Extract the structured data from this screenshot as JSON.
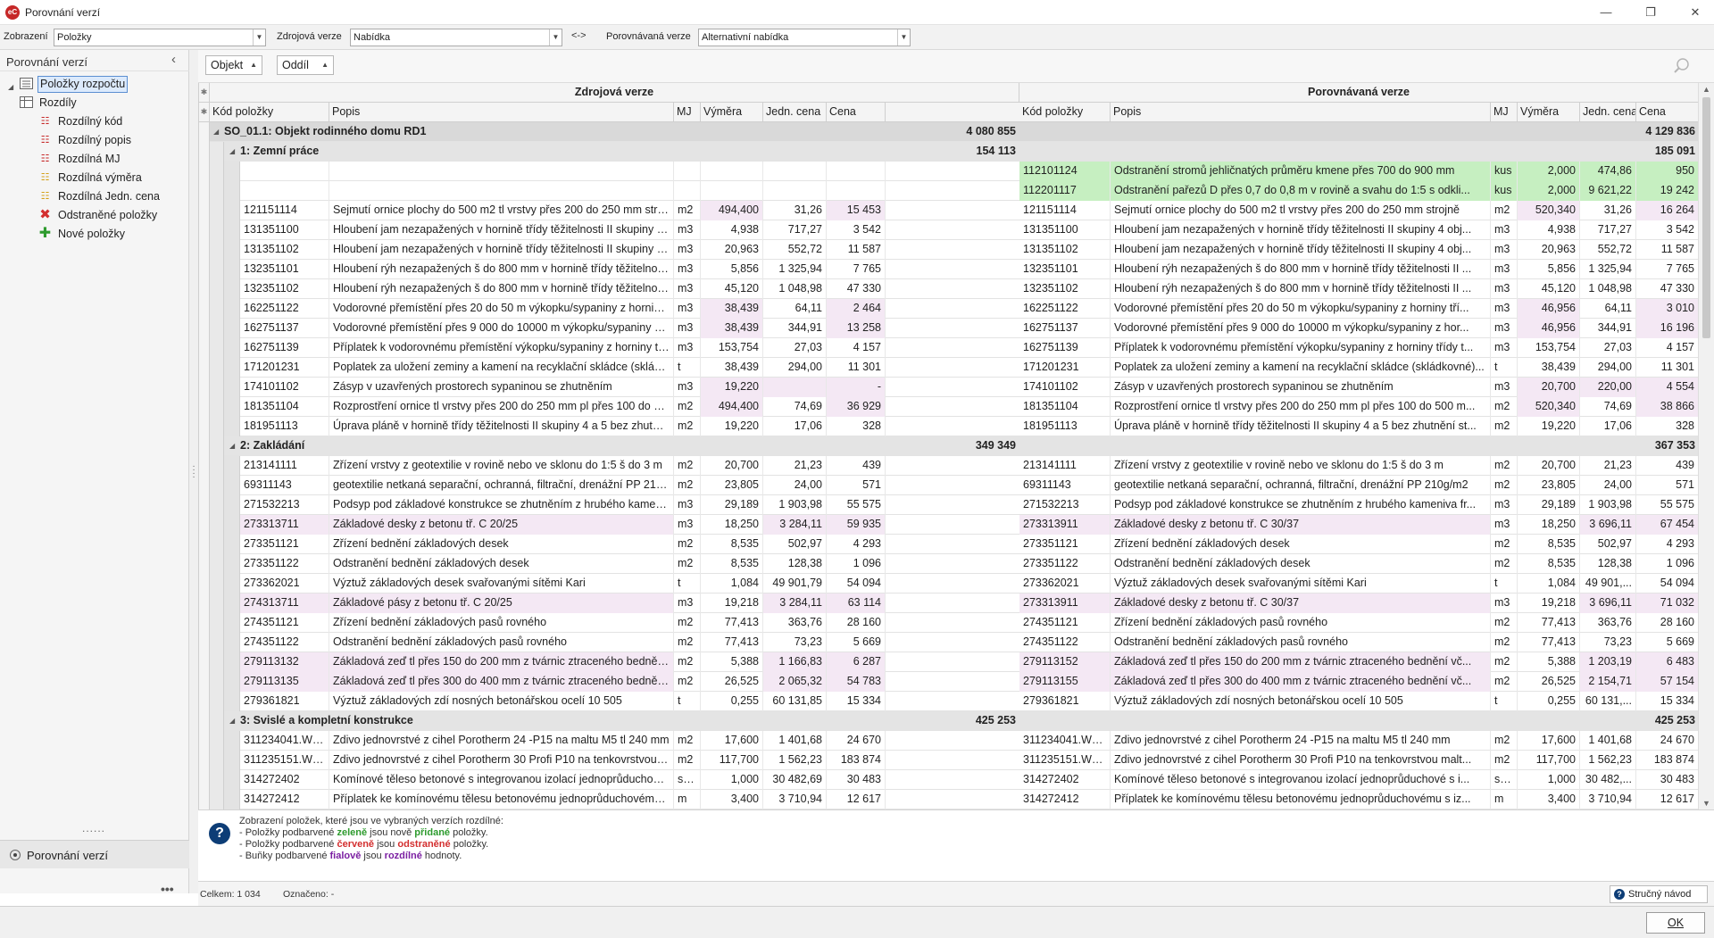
{
  "window": {
    "title": "Porovnání verzí",
    "app_icon": "eC",
    "controls": [
      "—",
      "❐",
      "✕"
    ]
  },
  "toolbar": {
    "view_label": "Zobrazení",
    "view_value": "Položky",
    "source_label": "Zdrojová verze",
    "source_value": "Nabídka",
    "swap_label": "<->",
    "compare_label": "Porovnávaná verze",
    "compare_value": "Alternativní nabídka"
  },
  "sidebar": {
    "title": "Porovnání verzí",
    "items": [
      {
        "label": "Položky rozpočtu",
        "icon": "list-icon"
      },
      {
        "label": "Rozdíly",
        "icon": "table-icon"
      },
      {
        "label": "Rozdílný kód",
        "icon": "diff-code-icon"
      },
      {
        "label": "Rozdílný popis",
        "icon": "diff-description-icon"
      },
      {
        "label": "Rozdílná MJ",
        "icon": "diff-unit-icon"
      },
      {
        "label": "Rozdílná výměra",
        "icon": "diff-quantity-icon"
      },
      {
        "label": "Rozdílná Jedn. cena",
        "icon": "diff-price-icon"
      },
      {
        "label": "Odstraněné položky",
        "icon": "red-x-icon"
      },
      {
        "label": "Nové položky",
        "icon": "green-plus-icon"
      }
    ],
    "dots": "......",
    "bottom_nav": "Porovnání verzí",
    "more": "•••"
  },
  "group_bar": {
    "buttons": [
      "Objekt",
      "Oddíl"
    ]
  },
  "grid": {
    "source_header": "Zdrojová verze",
    "compare_header": "Porovnávaná verze",
    "columns": [
      "Kód položky",
      "Popis",
      "MJ",
      "Výměra",
      "Jedn. cena",
      "Cena"
    ],
    "star": "✱",
    "rows": [
      {
        "t": "g1",
        "label": "SO_01.1: Objekt rodinného domu RD1",
        "sc": "4 080 855",
        "cc": "4 129 836"
      },
      {
        "t": "g2",
        "label": "1: Zemní práce",
        "sc": "154 113",
        "cc": "185 091"
      },
      {
        "t": "d",
        "sk": "",
        "sd": "",
        "su": "",
        "sq": "",
        "sp": "",
        "sc": "",
        "ck": "112101124",
        "cd": "Odstranění stromů jehličnatých průměru kmene přes 700 do 900 mm",
        "cu": "kus",
        "cq": "2,000",
        "cp": "474,86",
        "cc": "950",
        "hl": "new"
      },
      {
        "t": "d",
        "sk": "",
        "sd": "",
        "su": "",
        "sq": "",
        "sp": "",
        "sc": "",
        "ck": "112201117",
        "cd": "Odstranění pařezů D přes 0,7 do 0,8 m v rovině a svahu do 1:5 s odkli...",
        "cu": "kus",
        "cq": "2,000",
        "cp": "9 621,22",
        "cc": "19 242",
        "hl": "new"
      },
      {
        "t": "d",
        "sk": "121151114",
        "sd": "Sejmutí ornice plochy do 500 m2 tl vrstvy přes 200 do 250 mm strojně",
        "su": "m2",
        "sq": "494,400",
        "sp": "31,26",
        "sc": "15 453",
        "ck": "121151114",
        "cd": "Sejmutí ornice plochy do 500 m2 tl vrstvy přes 200 do 250 mm strojně",
        "cu": "m2",
        "cq": "520,340",
        "cp": "31,26",
        "cc": "16 264",
        "hl": "q"
      },
      {
        "t": "d",
        "sk": "131351100",
        "sd": "Hloubení jam nezapažených v hornině třídy těžitelnosti II skupiny 4 objem do 2...",
        "su": "m3",
        "sq": "4,938",
        "sp": "717,27",
        "sc": "3 542",
        "ck": "131351100",
        "cd": "Hloubení jam nezapažených v hornině třídy těžitelnosti II skupiny 4 obj...",
        "cu": "m3",
        "cq": "4,938",
        "cp": "717,27",
        "cc": "3 542",
        "hl": ""
      },
      {
        "t": "d",
        "sk": "131351102",
        "sd": "Hloubení jam nezapažených v hornině třídy těžitelnosti II skupiny 4 objem do 5...",
        "su": "m3",
        "sq": "20,963",
        "sp": "552,72",
        "sc": "11 587",
        "ck": "131351102",
        "cd": "Hloubení jam nezapažených v hornině třídy těžitelnosti II skupiny 4 obj...",
        "cu": "m3",
        "cq": "20,963",
        "cp": "552,72",
        "cc": "11 587",
        "hl": ""
      },
      {
        "t": "d",
        "sk": "132351101",
        "sd": "Hloubení rýh nezapažených š do 800 mm v hornině třídy těžitelnosti II skupiny ...",
        "su": "m3",
        "sq": "5,856",
        "sp": "1 325,94",
        "sc": "7 765",
        "ck": "132351101",
        "cd": "Hloubení rýh nezapažených š do 800 mm v hornině třídy těžitelnosti II ...",
        "cu": "m3",
        "cq": "5,856",
        "cp": "1 325,94",
        "cc": "7 765",
        "hl": ""
      },
      {
        "t": "d",
        "sk": "132351102",
        "sd": "Hloubení rýh nezapažených š do 800 mm v hornině třídy těžitelnosti II skupiny ...",
        "su": "m3",
        "sq": "45,120",
        "sp": "1 048,98",
        "sc": "47 330",
        "ck": "132351102",
        "cd": "Hloubení rýh nezapažených š do 800 mm v hornině třídy těžitelnosti II ...",
        "cu": "m3",
        "cq": "45,120",
        "cp": "1 048,98",
        "cc": "47 330",
        "hl": ""
      },
      {
        "t": "d",
        "sk": "162251122",
        "sd": "Vodorovné přemístění přes 20 do 50 m výkopku/sypaniny z horniny třídy těžite...",
        "su": "m3",
        "sq": "38,439",
        "sp": "64,11",
        "sc": "2 464",
        "ck": "162251122",
        "cd": "Vodorovné přemístění přes 20 do 50 m výkopku/sypaniny z horniny tří...",
        "cu": "m3",
        "cq": "46,956",
        "cp": "64,11",
        "cc": "3 010",
        "hl": "q"
      },
      {
        "t": "d",
        "sk": "162751137",
        "sd": "Vodorovné přemístění přes 9 000 do 10000 m výkopku/sypaniny z horniny tříd...",
        "su": "m3",
        "sq": "38,439",
        "sp": "344,91",
        "sc": "13 258",
        "ck": "162751137",
        "cd": "Vodorovné přemístění přes 9 000 do 10000 m výkopku/sypaniny z hor...",
        "cu": "m3",
        "cq": "46,956",
        "cp": "344,91",
        "cc": "16 196",
        "hl": "q"
      },
      {
        "t": "d",
        "sk": "162751139",
        "sd": "Příplatek k vodorovnému přemístění výkopku/sypaniny z horniny třídy těžitelno...",
        "su": "m3",
        "sq": "153,754",
        "sp": "27,03",
        "sc": "4 157",
        "ck": "162751139",
        "cd": "Příplatek k vodorovnému přemístění výkopku/sypaniny z horniny třídy t...",
        "cu": "m3",
        "cq": "153,754",
        "cp": "27,03",
        "cc": "4 157",
        "hl": ""
      },
      {
        "t": "d",
        "sk": "171201231",
        "sd": "Poplatek za uložení zeminy a kamení na recyklační skládce (skládkovné) kód od...",
        "su": "t",
        "sq": "38,439",
        "sp": "294,00",
        "sc": "11 301",
        "ck": "171201231",
        "cd": "Poplatek za uložení zeminy a kamení na recyklační skládce (skládkovné)...",
        "cu": "t",
        "cq": "38,439",
        "cp": "294,00",
        "cc": "11 301",
        "hl": ""
      },
      {
        "t": "d",
        "sk": "174101102",
        "sd": "Zásyp v uzavřených prostorech sypaninou se zhutněním",
        "su": "m3",
        "sq": "19,220",
        "sp": "",
        "sc": "-",
        "ck": "174101102",
        "cd": "Zásyp v uzavřených prostorech sypaninou se zhutněním",
        "cu": "m3",
        "cq": "20,700",
        "cp": "220,00",
        "cc": "4 554",
        "hl": "qp"
      },
      {
        "t": "d",
        "sk": "181351104",
        "sd": "Rozprostření ornice tl vrstvy přes 200 do 250 mm pl přes 100 do 500 m2 v rov...",
        "su": "m2",
        "sq": "494,400",
        "sp": "74,69",
        "sc": "36 929",
        "ck": "181351104",
        "cd": "Rozprostření ornice tl vrstvy přes 200 do 250 mm pl přes 100 do 500 m...",
        "cu": "m2",
        "cq": "520,340",
        "cp": "74,69",
        "cc": "38 866",
        "hl": "q"
      },
      {
        "t": "d",
        "sk": "181951113",
        "sd": "Úprava pláně v hornině třídy těžitelnosti II skupiny 4 a 5 bez zhutnění strojně",
        "su": "m2",
        "sq": "19,220",
        "sp": "17,06",
        "sc": "328",
        "ck": "181951113",
        "cd": "Úprava pláně v hornině třídy těžitelnosti II skupiny 4 a 5 bez zhutnění st...",
        "cu": "m2",
        "cq": "19,220",
        "cp": "17,06",
        "cc": "328",
        "hl": ""
      },
      {
        "t": "g2",
        "label": "2: Zakládání",
        "sc": "349 349",
        "cc": "367 353"
      },
      {
        "t": "d",
        "sk": "213141111",
        "sd": "Zřízení vrstvy z geotextilie v rovině nebo ve sklonu do 1:5 š do 3 m",
        "su": "m2",
        "sq": "20,700",
        "sp": "21,23",
        "sc": "439",
        "ck": "213141111",
        "cd": "Zřízení vrstvy z geotextilie v rovině nebo ve sklonu do 1:5 š do 3 m",
        "cu": "m2",
        "cq": "20,700",
        "cp": "21,23",
        "cc": "439",
        "hl": ""
      },
      {
        "t": "d",
        "sk": "69311143",
        "sd": "geotextilie netkaná separační, ochranná, filtrační, drenážní PP 210g/m2",
        "su": "m2",
        "sq": "23,805",
        "sp": "24,00",
        "sc": "571",
        "ck": "69311143",
        "cd": "geotextilie netkaná separační, ochranná, filtrační, drenážní PP 210g/m2",
        "cu": "m2",
        "cq": "23,805",
        "cp": "24,00",
        "cc": "571",
        "hl": ""
      },
      {
        "t": "d",
        "sk": "271532213",
        "sd": "Podsyp pod základové konstrukce se zhutněním z hrubého kameniva frakce 8 ...",
        "su": "m3",
        "sq": "29,189",
        "sp": "1 903,98",
        "sc": "55 575",
        "ck": "271532213",
        "cd": "Podsyp pod základové konstrukce se zhutněním z hrubého kameniva fr...",
        "cu": "m3",
        "cq": "29,189",
        "cp": "1 903,98",
        "cc": "55 575",
        "hl": ""
      },
      {
        "t": "d",
        "sk": "273313711",
        "sd": "Základové desky z betonu tř. C 20/25",
        "su": "m3",
        "sq": "18,250",
        "sp": "3 284,11",
        "sc": "59 935",
        "ck": "273313911",
        "cd": "Základové desky z betonu tř. C 30/37",
        "cu": "m3",
        "cq": "18,250",
        "cp": "3 696,11",
        "cc": "67 454",
        "hl": "kdp"
      },
      {
        "t": "d",
        "sk": "273351121",
        "sd": "Zřízení bednění základových desek",
        "su": "m2",
        "sq": "8,535",
        "sp": "502,97",
        "sc": "4 293",
        "ck": "273351121",
        "cd": "Zřízení bednění základových desek",
        "cu": "m2",
        "cq": "8,535",
        "cp": "502,97",
        "cc": "4 293",
        "hl": ""
      },
      {
        "t": "d",
        "sk": "273351122",
        "sd": "Odstranění bednění základových desek",
        "su": "m2",
        "sq": "8,535",
        "sp": "128,38",
        "sc": "1 096",
        "ck": "273351122",
        "cd": "Odstranění bednění základových desek",
        "cu": "m2",
        "cq": "8,535",
        "cp": "128,38",
        "cc": "1 096",
        "hl": ""
      },
      {
        "t": "d",
        "sk": "273362021",
        "sd": "Výztuž základových desek svařovanými sítěmi Kari",
        "su": "t",
        "sq": "1,084",
        "sp": "49 901,79",
        "sc": "54 094",
        "ck": "273362021",
        "cd": "Výztuž základových desek svařovanými sítěmi Kari",
        "cu": "t",
        "cq": "1,084",
        "cp": "49 901,...",
        "cc": "54 094",
        "hl": ""
      },
      {
        "t": "d",
        "sk": "274313711",
        "sd": "Základové pásy z betonu tř. C 20/25",
        "su": "m3",
        "sq": "19,218",
        "sp": "3 284,11",
        "sc": "63 114",
        "ck": "273313911",
        "cd": "Základové desky z betonu tř. C 30/37",
        "cu": "m3",
        "cq": "19,218",
        "cp": "3 696,11",
        "cc": "71 032",
        "hl": "kdp"
      },
      {
        "t": "d",
        "sk": "274351121",
        "sd": "Zřízení bednění základových pasů rovného",
        "su": "m2",
        "sq": "77,413",
        "sp": "363,76",
        "sc": "28 160",
        "ck": "274351121",
        "cd": "Zřízení bednění základových pasů rovného",
        "cu": "m2",
        "cq": "77,413",
        "cp": "363,76",
        "cc": "28 160",
        "hl": ""
      },
      {
        "t": "d",
        "sk": "274351122",
        "sd": "Odstranění bednění základových pasů rovného",
        "su": "m2",
        "sq": "77,413",
        "sp": "73,23",
        "sc": "5 669",
        "ck": "274351122",
        "cd": "Odstranění bednění základových pasů rovného",
        "cu": "m2",
        "cq": "77,413",
        "cp": "73,23",
        "cc": "5 669",
        "hl": ""
      },
      {
        "t": "d",
        "sk": "279113132",
        "sd": "Základová zeď tl přes 150 do 200 mm z tvárnic ztraceného bednění včetně výp...",
        "su": "m2",
        "sq": "5,388",
        "sp": "1 166,83",
        "sc": "6 287",
        "ck": "279113152",
        "cd": "Základová zeď tl přes 150 do 200 mm z tvárnic ztraceného bednění vč...",
        "cu": "m2",
        "cq": "5,388",
        "cp": "1 203,19",
        "cc": "6 483",
        "hl": "kdp"
      },
      {
        "t": "d",
        "sk": "279113135",
        "sd": "Základová zeď tl přes 300 do 400 mm z tvárnic ztraceného bednění včetně výp...",
        "su": "m2",
        "sq": "26,525",
        "sp": "2 065,32",
        "sc": "54 783",
        "ck": "279113155",
        "cd": "Základová zeď tl přes 300 do 400 mm z tvárnic ztraceného bednění vč...",
        "cu": "m2",
        "cq": "26,525",
        "cp": "2 154,71",
        "cc": "57 154",
        "hl": "kdp"
      },
      {
        "t": "d",
        "sk": "279361821",
        "sd": "Výztuž základových zdí nosných betonářskou ocelí 10 505",
        "su": "t",
        "sq": "0,255",
        "sp": "60 131,85",
        "sc": "15 334",
        "ck": "279361821",
        "cd": "Výztuž základových zdí nosných betonářskou ocelí 10 505",
        "cu": "t",
        "cq": "0,255",
        "cp": "60 131,...",
        "cc": "15 334",
        "hl": ""
      },
      {
        "t": "g2",
        "label": "3: Svislé a kompletní konstrukce",
        "sc": "425 253",
        "cc": "425 253"
      },
      {
        "t": "d",
        "sk": "311234041.WNR",
        "sd": "Zdivo jednovrstvé z cihel Porotherm 24 -P15 na maltu M5 tl 240 mm",
        "su": "m2",
        "sq": "17,600",
        "sp": "1 401,68",
        "sc": "24 670",
        "ck": "311234041.WNR",
        "cd": "Zdivo jednovrstvé z cihel Porotherm 24 -P15 na maltu M5 tl 240 mm",
        "cu": "m2",
        "cq": "17,600",
        "cp": "1 401,68",
        "cc": "24 670",
        "hl": ""
      },
      {
        "t": "d",
        "sk": "311235151.WNR",
        "sd": "Zdivo jednovrstvé z cihel Porotherm 30 Profi P10 na tenkovrstvou maltu tl 300 ...",
        "su": "m2",
        "sq": "117,700",
        "sp": "1 562,23",
        "sc": "183 874",
        "ck": "311235151.WNR",
        "cd": "Zdivo jednovrstvé z cihel Porotherm 30 Profi P10 na tenkovrstvou malt...",
        "cu": "m2",
        "cq": "117,700",
        "cp": "1 562,23",
        "cc": "183 874",
        "hl": ""
      },
      {
        "t": "d",
        "sk": "314272402",
        "sd": "Komínové těleso betonové s integrovanou izolací jednoprůduchové s izostatic...",
        "su": "so...",
        "sq": "1,000",
        "sp": "30 482,69",
        "sc": "30 483",
        "ck": "314272402",
        "cd": "Komínové těleso betonové s integrovanou izolací jednoprůduchové s i...",
        "cu": "so...",
        "cq": "1,000",
        "cp": "30 482,...",
        "cc": "30 483",
        "hl": ""
      },
      {
        "t": "d",
        "sk": "314272412",
        "sd": "Příplatek ke komínovému tělesu betonovému jednoprůduchovému s izostatický...",
        "su": "m",
        "sq": "3,400",
        "sp": "3 710,94",
        "sc": "12 617",
        "ck": "314272412",
        "cd": "Příplatek ke komínovému tělesu betonovému jednoprůduchovému s iz...",
        "cu": "m",
        "cq": "3,400",
        "cp": "3 710,94",
        "cc": "12 617",
        "hl": ""
      }
    ]
  },
  "legend": {
    "line0": "Zobrazení položek, které jsou ve vybraných verzích rozdílné:",
    "l1_a": "- Položky podbarvené ",
    "l1_b": "zeleně",
    "l1_c": " jsou nově ",
    "l1_d": "přidané",
    "l1_e": " položky.",
    "l2_a": "- Položky podbarvené ",
    "l2_b": "červeně",
    "l2_c": " jsou ",
    "l2_d": "odstraněné",
    "l2_e": " položky.",
    "l3_a": "- Buňky podbarvené ",
    "l3_b": "fialově",
    "l3_c": " jsou ",
    "l3_d": "rozdílné",
    "l3_e": " hodnoty.",
    "green": "#2e9b2e",
    "red": "#d32f2f",
    "purple": "#7b1fa2"
  },
  "status": {
    "total": "Celkem: 1 034",
    "selected": "Označeno: -",
    "help": "Stručný návod"
  },
  "footer": {
    "ok": "OK"
  }
}
